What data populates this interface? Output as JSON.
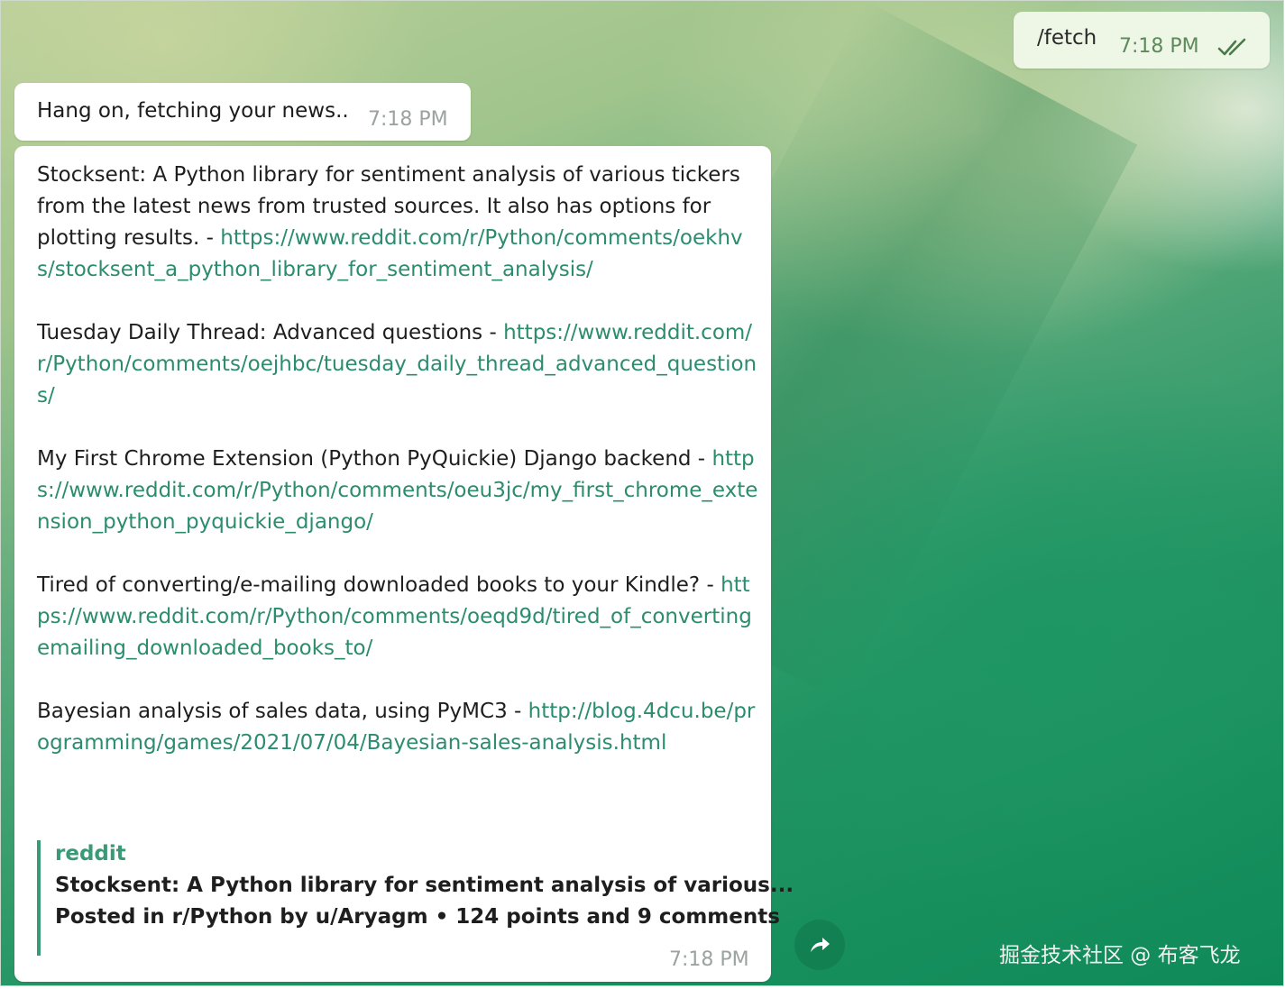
{
  "outgoing": {
    "text": "/fetch",
    "time": "7:18 PM"
  },
  "incoming_status": {
    "text": "Hang on, fetching your news..",
    "time": "7:18 PM"
  },
  "news_message": {
    "items": [
      {
        "title": "Stocksent: A Python library for sentiment analysis of various tickers from the latest news from trusted sources. It also has options for plotting results. -",
        "url": "https://www.reddit.com/r/Python/comments/oekhvs/stocksent_a_python_library_for_sentiment_analysis/"
      },
      {
        "title": "Tuesday Daily Thread: Advanced questions -",
        "url": "https://www.reddit.com/r/Python/comments/oejhbc/tuesday_daily_thread_advanced_questions/"
      },
      {
        "title": "My First Chrome Extension (Python PyQuickie) Django backend -",
        "url": "https://www.reddit.com/r/Python/comments/oeu3jc/my_first_chrome_extension_python_pyquickie_django/"
      },
      {
        "title": "Tired of converting/e-mailing downloaded books to your Kindle? -",
        "url": "https://www.reddit.com/r/Python/comments/oeqd9d/tired_of_convertingemailing_downloaded_books_to/"
      },
      {
        "title": "Bayesian analysis of sales data, using PyMC3 -",
        "url": "http://blog.4dcu.be/programming/games/2021/07/04/Bayesian-sales-analysis.html"
      }
    ],
    "preview": {
      "site": "reddit",
      "title": "Stocksent: A Python library for sentiment analysis of various...",
      "description": "Posted in r/Python by u/Aryagm • 124 points and 9 comments"
    },
    "time": "7:18 PM"
  },
  "watermark": "掘金技术社区 @ 布客飞龙",
  "icons": {
    "read_status": "double-check-icon",
    "share": "share-arrow-icon"
  }
}
